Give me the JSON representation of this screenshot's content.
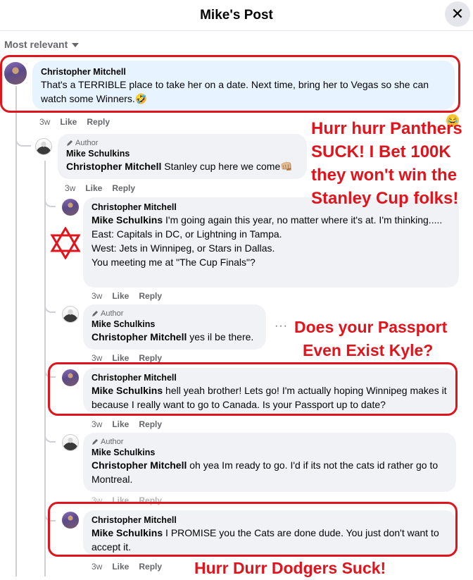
{
  "header": {
    "title": "Mike's Post",
    "close_glyph": "✕"
  },
  "sort": {
    "label": "Most relevant"
  },
  "comments": [
    {
      "author": "Christopher Mitchell",
      "text": "That's a TERRIBLE place to take her on a date. Next time, bring her to Vegas so she can watch some Winners.🤣",
      "time": "3w",
      "like": "Like",
      "reply": "Reply"
    },
    {
      "badge": "Author",
      "author": "Mike Schulkins",
      "tag": "Christopher Mitchell",
      "text": " Stanley cup here we come👊🏼",
      "time": "3w",
      "like": "Like",
      "reply": "Reply"
    },
    {
      "author": "Christopher Mitchell",
      "tag": "Mike Schulkins",
      "text": " I'm going again this year, no matter where it's at. I'm thinking.....",
      "line2": "East: Capitals in DC, or Lightning in Tampa.",
      "line3": "West: Jets in Winnipeg, or Stars in Dallas.",
      "line4": "You meeting me at \"The Cup Finals\"?",
      "time": "3w",
      "like": "Like",
      "reply": "Reply"
    },
    {
      "badge": "Author",
      "author": "Mike Schulkins",
      "tag": "Christopher Mitchell",
      "text": " yes il be there.",
      "time": "3w",
      "like": "Like",
      "reply": "Reply"
    },
    {
      "author": "Christopher Mitchell",
      "tag": "Mike Schulkins",
      "text": " hell yeah brother! Lets go! I'm actually hoping Winnipeg makes it because I really want to go to Canada. Is your Passport up to date?",
      "time": "3w",
      "like": "Like",
      "reply": "Reply"
    },
    {
      "badge": "Author",
      "author": "Mike Schulkins",
      "tag": "Christopher Mitchell",
      "text": " oh yea Im ready to go. I'd if its not the cats id rather go to Montreal.",
      "time": "3w",
      "like": "Like",
      "reply": "Reply"
    },
    {
      "author": "Christopher Mitchell",
      "tag": "Mike Schulkins",
      "text": " I PROMISE you the Cats are done dude. You just don't want to accept it.",
      "time": "3w",
      "like": "Like",
      "reply": "Reply"
    }
  ],
  "annotations": {
    "a1_l1": "Hurr hurr Panthers",
    "a1_l2": "SUCK! I Bet 100K",
    "a1_l3": "they won't win the",
    "a1_l4": "Stanley Cup folks!",
    "a2_l1": "Does your Passport",
    "a2_l2": "Even Exist Kyle?",
    "a3": "Hurr Durr Dodgers Suck!"
  },
  "accent_red": "#e0141c",
  "icons": [
    "close-icon",
    "chevron-down-icon",
    "pencil-icon",
    "star-of-david-icon",
    "more-dots-icon"
  ]
}
